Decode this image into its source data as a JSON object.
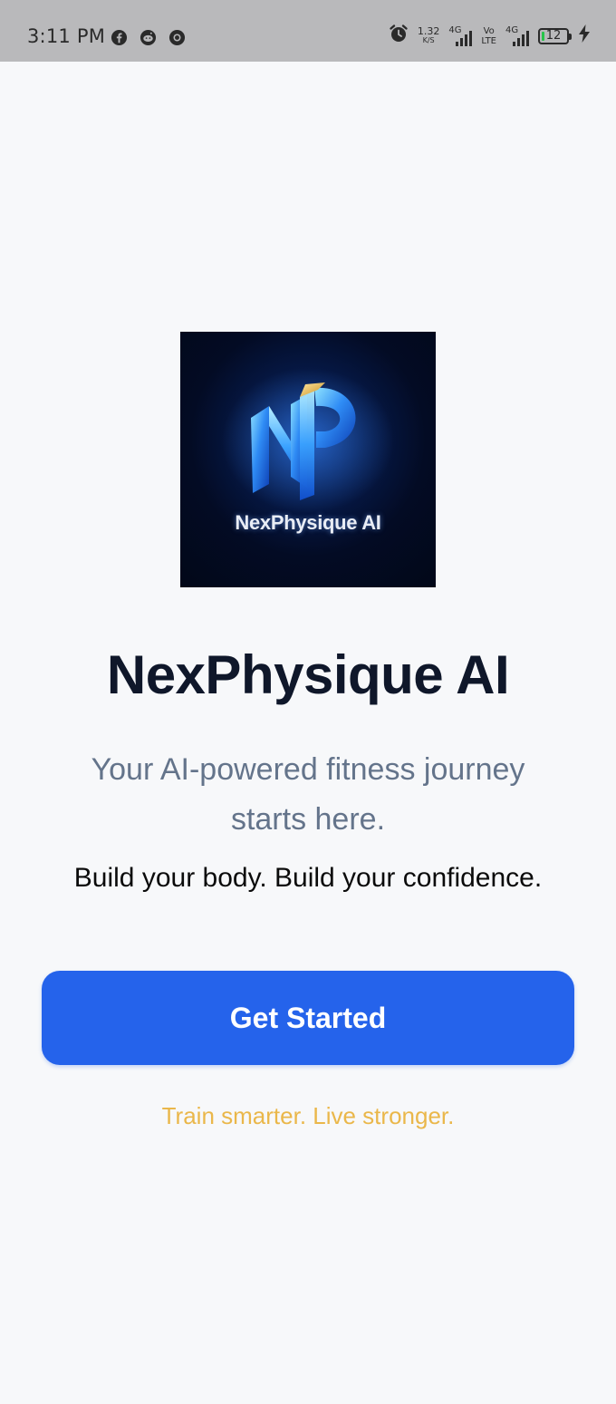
{
  "status_bar": {
    "time": "3:11 PM",
    "left_icons": [
      "facebook-icon",
      "reddit-icon",
      "chrome-icon"
    ],
    "net_speed_value": "1.32",
    "net_speed_unit": "K/S",
    "sim1_label": "4G",
    "volte_top": "Vo",
    "volte_bottom": "LTE",
    "sim2_label": "4G",
    "battery_level": "12",
    "battery_fraction": 0.12,
    "charging_icon": "bolt-icon",
    "alarm_icon": "alarm-icon"
  },
  "logo": {
    "monogram_icon": "np-monogram-logo",
    "caption": "NexPhysique AI"
  },
  "main": {
    "title": "NexPhysique AI",
    "subtitle": "Your AI-powered fitness journey starts here.",
    "motto": "Build your body. Build your confidence.",
    "cta_label": "Get Started",
    "tagline": "Train smarter. Live stronger."
  },
  "colors": {
    "background": "#f7f8fa",
    "title": "#0f172a",
    "subtitle": "#64748b",
    "cta": "#2563eb",
    "tagline": "#eab74a",
    "status_bar": "#b9b9bb"
  }
}
